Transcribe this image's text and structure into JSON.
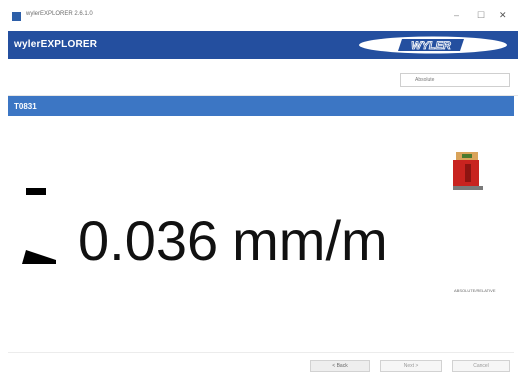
{
  "window": {
    "title": "wylerEXPLORER 2.6.1.0",
    "minimize": "–",
    "maximize": "☐",
    "close": "✕"
  },
  "header": {
    "app_name": "wylerEXPLORER",
    "logo_text": "WYLER"
  },
  "toolbar": {
    "mode_select_value": "Absolute"
  },
  "sensor": {
    "name": "T0831"
  },
  "reading": {
    "value": "0.036",
    "unit": "mm/m"
  },
  "main": {
    "mode_label": "ABSOLUTE/RELATIVE"
  },
  "footer": {
    "back_label": "< Back",
    "next_label": "Next >",
    "cancel_label": "Cancel"
  },
  "colors": {
    "header_bg": "#244f9f",
    "sensor_bar_bg": "#3c76c4",
    "device_red": "#c8231f",
    "device_top": "#d9a35a"
  }
}
